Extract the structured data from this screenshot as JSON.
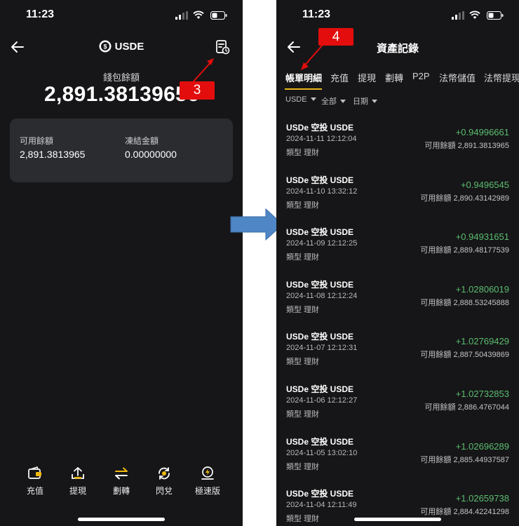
{
  "left": {
    "status_time": "11:23",
    "title": "USDE",
    "wallet_label": "錢包餘額",
    "wallet_amount": "2,891.38139656",
    "available_label": "可用餘額",
    "available_value": "2,891.3813965",
    "frozen_label": "凍結金額",
    "frozen_value": "0.00000000",
    "nav": [
      {
        "label": "充值",
        "icon": "wallet-icon"
      },
      {
        "label": "提現",
        "icon": "upload-icon"
      },
      {
        "label": "劃轉",
        "icon": "transfer-icon"
      },
      {
        "label": "閃兌",
        "icon": "swap-icon"
      },
      {
        "label": "極速版",
        "icon": "lightning-icon"
      }
    ],
    "badge": "3"
  },
  "right": {
    "status_time": "11:23",
    "title": "資產記錄",
    "badge": "4",
    "tabs": [
      "帳單明細",
      "充值",
      "提現",
      "劃轉",
      "P2P",
      "法幣儲值",
      "法幣提現"
    ],
    "filters": [
      "USDE",
      "全部",
      "日期"
    ],
    "records": [
      {
        "name": "USDe 空投 USDE",
        "date": "2024-11-11 12:12:04",
        "type": "類型 理財",
        "amount": "+0.94996661",
        "available": "可用餘額 2,891.3813965"
      },
      {
        "name": "USDe 空投 USDE",
        "date": "2024-11-10 13:32:12",
        "type": "類型 理財",
        "amount": "+0.9496545",
        "available": "可用餘額 2,890.43142989"
      },
      {
        "name": "USDe 空投 USDE",
        "date": "2024-11-09 12:12:25",
        "type": "類型 理財",
        "amount": "+0.94931651",
        "available": "可用餘額 2,889.48177539"
      },
      {
        "name": "USDe 空投 USDE",
        "date": "2024-11-08 12:12:24",
        "type": "類型 理財",
        "amount": "+1.02806019",
        "available": "可用餘額 2,888.53245888"
      },
      {
        "name": "USDe 空投 USDE",
        "date": "2024-11-07 12:12:31",
        "type": "類型 理財",
        "amount": "+1.02769429",
        "available": "可用餘額 2,887.50439869"
      },
      {
        "name": "USDe 空投 USDE",
        "date": "2024-11-06 12:12:27",
        "type": "類型 理財",
        "amount": "+1.02732853",
        "available": "可用餘額 2,886.4767044"
      },
      {
        "name": "USDe 空投 USDE",
        "date": "2024-11-05 13:02:10",
        "type": "類型 理財",
        "amount": "+1.02696289",
        "available": "可用餘額 2,885.44937587"
      },
      {
        "name": "USDe 空投 USDE",
        "date": "2024-11-04 12:11:49",
        "type": "類型 理財",
        "amount": "+1.02659738",
        "available": "可用餘額 2,884.42241298"
      }
    ]
  },
  "colors": {
    "background": "#161618",
    "card": "#2b2c30",
    "accent": "#e8b71d",
    "positive": "#5bbd6f",
    "annotation": "#e30d0d",
    "arrow": "#4f86c6"
  }
}
